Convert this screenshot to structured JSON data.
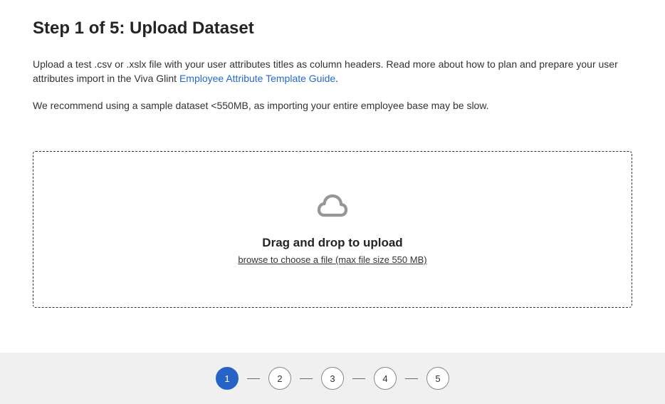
{
  "title": "Step 1 of 5: Upload Dataset",
  "instructions": {
    "pre": "Upload a test .csv or .xslx file with your user attributes titles as column headers. Read more about how to plan and prepare your user attributes import in the Viva Glint ",
    "link": "Employee Attribute Template Guide",
    "post": "."
  },
  "recommendation": "We recommend using a sample dataset <550MB, as importing your entire employee base may be slow.",
  "dropzone": {
    "title": "Drag and drop to upload",
    "subtitle": "browse to choose a file (max file size 550 MB)"
  },
  "stepper": {
    "current": 1,
    "steps": [
      "1",
      "2",
      "3",
      "4",
      "5"
    ]
  }
}
